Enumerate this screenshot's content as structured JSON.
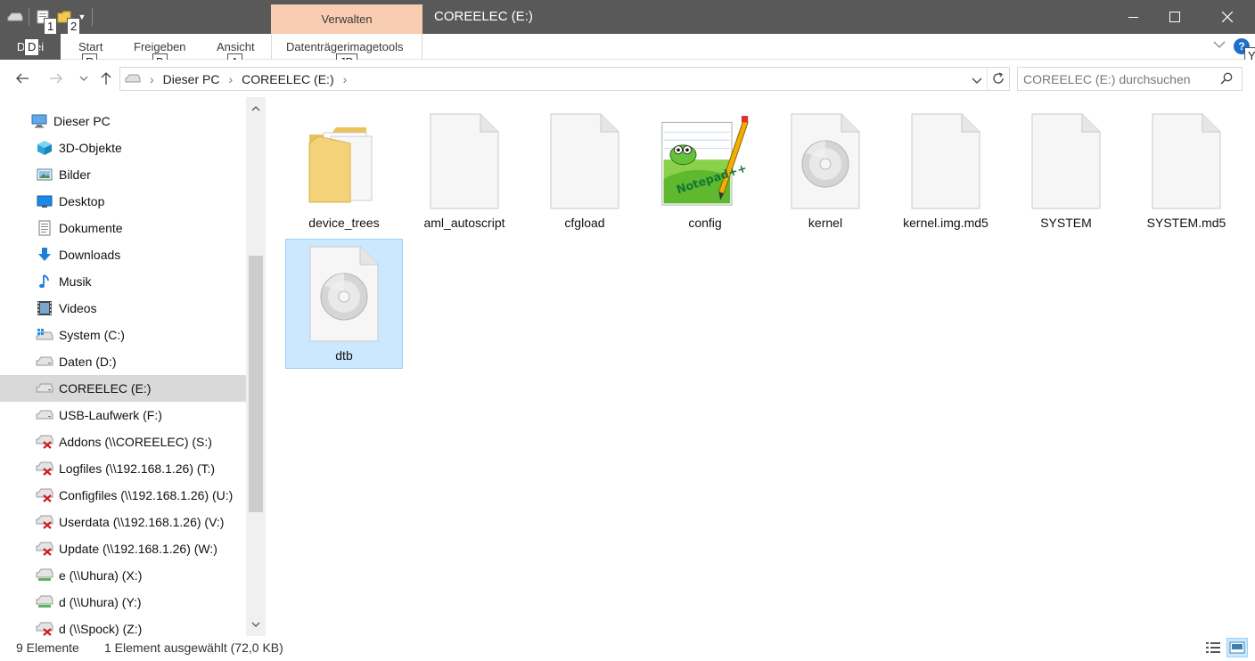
{
  "titlebar": {
    "title": "COREELEC (E:)",
    "manage_tab": "Verwalten",
    "qat_keytips": [
      "1",
      "2"
    ]
  },
  "ribbon": {
    "file_tab": "Datei",
    "file_keytip": "D",
    "tabs": [
      {
        "label": "Start",
        "keytip": "R"
      },
      {
        "label": "Freigeben",
        "keytip": "B"
      },
      {
        "label": "Ansicht",
        "keytip": "A"
      },
      {
        "label": "Datenträgerimagetools",
        "keytip": "JD"
      }
    ],
    "help_keytip": "Y"
  },
  "address": {
    "breadcrumbs": [
      "Dieser PC",
      "COREELEC (E:)"
    ],
    "search_placeholder": "COREELEC (E:) durchsuchen"
  },
  "navpane": {
    "items": [
      {
        "label": "Dieser PC",
        "icon": "computer-icon"
      },
      {
        "label": "3D-Objekte",
        "icon": "3d-objects-icon"
      },
      {
        "label": "Bilder",
        "icon": "pictures-icon"
      },
      {
        "label": "Desktop",
        "icon": "desktop-icon"
      },
      {
        "label": "Dokumente",
        "icon": "documents-icon"
      },
      {
        "label": "Downloads",
        "icon": "downloads-icon"
      },
      {
        "label": "Musik",
        "icon": "music-icon"
      },
      {
        "label": "Videos",
        "icon": "videos-icon"
      },
      {
        "label": "System (C:)",
        "icon": "windows-drive-icon"
      },
      {
        "label": "Daten (D:)",
        "icon": "drive-icon"
      },
      {
        "label": "COREELEC (E:)",
        "icon": "drive-icon",
        "selected": true
      },
      {
        "label": "USB-Laufwerk (F:)",
        "icon": "drive-icon"
      },
      {
        "label": "Addons (\\\\COREELEC) (S:)",
        "icon": "disconnected-drive-icon"
      },
      {
        "label": "Logfiles (\\\\192.168.1.26) (T:)",
        "icon": "disconnected-drive-icon"
      },
      {
        "label": "Configfiles (\\\\192.168.1.26) (U:)",
        "icon": "disconnected-drive-icon"
      },
      {
        "label": "Userdata (\\\\192.168.1.26) (V:)",
        "icon": "disconnected-drive-icon"
      },
      {
        "label": "Update (\\\\192.168.1.26) (W:)",
        "icon": "disconnected-drive-icon"
      },
      {
        "label": "e (\\\\Uhura) (X:)",
        "icon": "network-drive-icon"
      },
      {
        "label": "d (\\\\Uhura) (Y:)",
        "icon": "network-drive-icon"
      },
      {
        "label": "d (\\\\Spock) (Z:)",
        "icon": "disconnected-drive-icon"
      }
    ]
  },
  "files": [
    {
      "name": "device_trees",
      "icon": "folder-icon"
    },
    {
      "name": "aml_autoscript",
      "icon": "blank-file-icon"
    },
    {
      "name": "cfgload",
      "icon": "blank-file-icon"
    },
    {
      "name": "config",
      "icon": "notepad-plus-plus-icon"
    },
    {
      "name": "kernel",
      "icon": "disc-image-icon"
    },
    {
      "name": "kernel.img.md5",
      "icon": "blank-file-icon"
    },
    {
      "name": "SYSTEM",
      "icon": "blank-file-icon"
    },
    {
      "name": "SYSTEM.md5",
      "icon": "blank-file-icon"
    },
    {
      "name": "dtb",
      "icon": "disc-image-icon",
      "selected": true
    }
  ],
  "status": {
    "count": "9 Elemente",
    "selection": "1 Element ausgewählt (72,0 KB)"
  },
  "colors": {
    "titlebar": "#595959",
    "manage_tab": "#f9cdb2",
    "selection": "#cce8ff",
    "nav_selected": "#d9d9d9"
  }
}
